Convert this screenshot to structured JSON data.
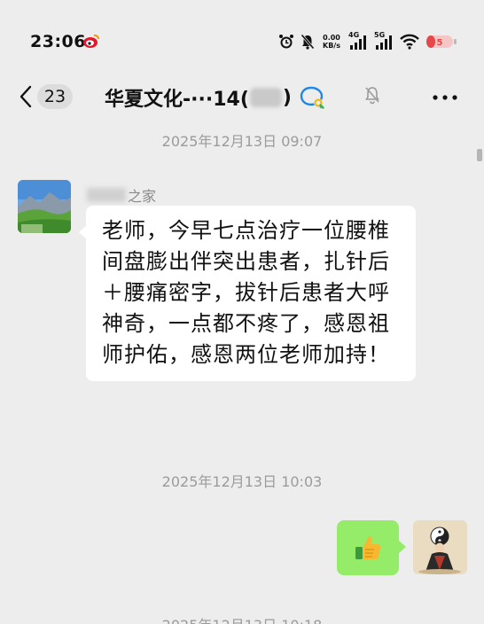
{
  "status_bar": {
    "time": "23:06",
    "net_speed_value": "0.00",
    "net_speed_unit": "KB/s",
    "sim1_label": "4G",
    "sim2_label": "5G",
    "battery_level": "5",
    "icons": [
      "weibo-icon",
      "alarm-icon",
      "mute-icon",
      "signal-icon",
      "wifi-icon",
      "battery-icon"
    ]
  },
  "header": {
    "unread_count": "23",
    "title_prefix": "华夏文化-···14(",
    "title_suffix": ")"
  },
  "messages": {
    "timestamp_1": "2025年12月13日 09:07",
    "sender_name_suffix": "之家",
    "text_1": "老师，今早七点治疗一位腰椎间盘膨出伴突出患者，扎针后＋腰痛密字，拔针后患者大呼神奇，一点都不疼了，感恩祖师护佑，感恩两位老师加持！",
    "timestamp_2": "2025年12月13日 10:03",
    "sticker_emoji": "👍",
    "timestamp_3": "2025年12月13日 10:18"
  },
  "colors": {
    "background": "#ededed",
    "bubble_self": "#95ec69",
    "bubble_other": "#ffffff",
    "battery_accent": "#e54848"
  }
}
